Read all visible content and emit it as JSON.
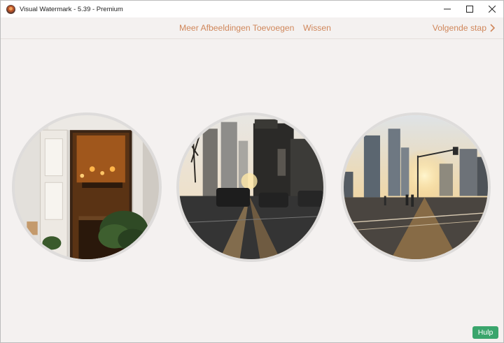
{
  "window": {
    "title": "Visual Watermark - 5.39 - Premium",
    "controls": {
      "minimize": "─",
      "maximize": "☐",
      "close": "✕"
    }
  },
  "toolbar": {
    "add_more_images": "Meer Afbeeldingen Toevoegen",
    "clear": "Wissen",
    "next_step": "Volgende stap",
    "next_icon": "chevron-right-icon",
    "link_color": "#d0875b"
  },
  "images": [
    {
      "name": "doorway-cafe-photo"
    },
    {
      "name": "city-street-sunset-photo"
    },
    {
      "name": "skyline-crosswalk-sunset-photo"
    }
  ],
  "help": {
    "label": "Hulp",
    "color": "#3aa56c"
  }
}
